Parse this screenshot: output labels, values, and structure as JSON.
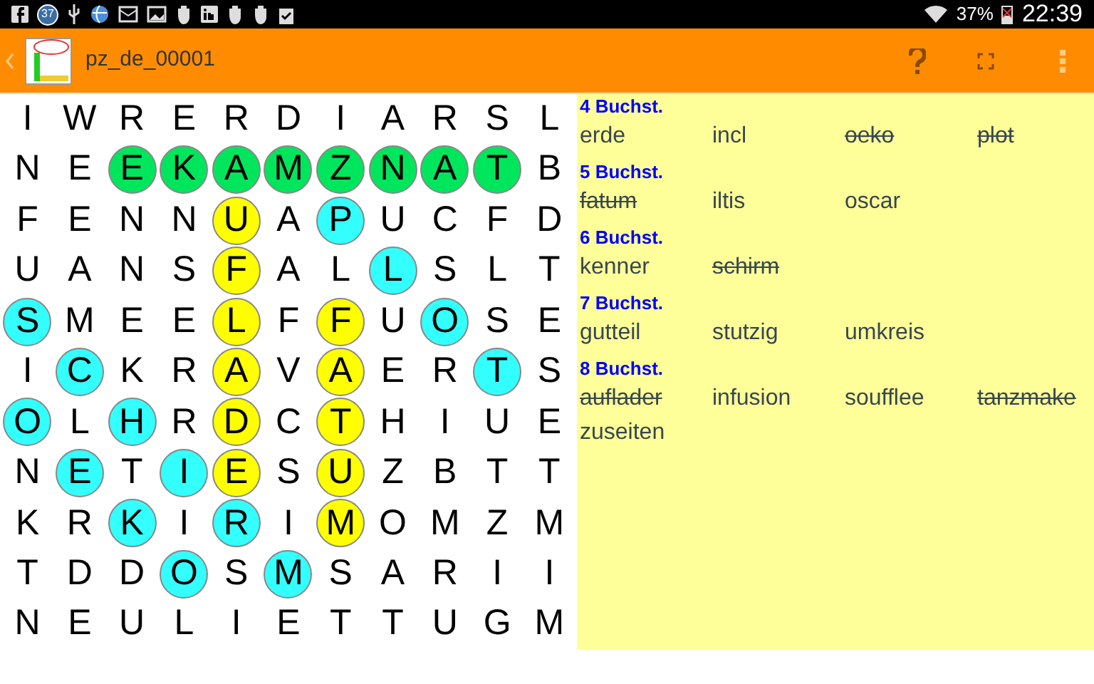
{
  "status_bar": {
    "notification_badge": "37",
    "battery": "37%",
    "time": "22:39"
  },
  "action_bar": {
    "title": "pz_de_00001"
  },
  "grid": {
    "rows": [
      [
        {
          "letter": "I"
        },
        {
          "letter": "W"
        },
        {
          "letter": "R"
        },
        {
          "letter": "E"
        },
        {
          "letter": "R"
        },
        {
          "letter": "D"
        },
        {
          "letter": "I"
        },
        {
          "letter": "A"
        },
        {
          "letter": "R"
        },
        {
          "letter": "S"
        },
        {
          "letter": "L"
        }
      ],
      [
        {
          "letter": "N"
        },
        {
          "letter": "E"
        },
        {
          "letter": "E",
          "color": "#00e65c"
        },
        {
          "letter": "K",
          "color": "#00e65c"
        },
        {
          "letter": "A",
          "color": "#00e65c"
        },
        {
          "letter": "M",
          "color": "#00e65c"
        },
        {
          "letter": "Z",
          "color": "#00e65c"
        },
        {
          "letter": "N",
          "color": "#00e65c"
        },
        {
          "letter": "A",
          "color": "#00e65c"
        },
        {
          "letter": "T",
          "color": "#00e65c"
        },
        {
          "letter": "B"
        }
      ],
      [
        {
          "letter": "F"
        },
        {
          "letter": "E"
        },
        {
          "letter": "N"
        },
        {
          "letter": "N"
        },
        {
          "letter": "U",
          "color": "#ffff00"
        },
        {
          "letter": "A"
        },
        {
          "letter": "P",
          "color": "#33ffff"
        },
        {
          "letter": "U"
        },
        {
          "letter": "C"
        },
        {
          "letter": "F"
        },
        {
          "letter": "D"
        }
      ],
      [
        {
          "letter": "U"
        },
        {
          "letter": "A"
        },
        {
          "letter": "N"
        },
        {
          "letter": "S"
        },
        {
          "letter": "F",
          "color": "#ffff00"
        },
        {
          "letter": "A"
        },
        {
          "letter": "L"
        },
        {
          "letter": "L",
          "color": "#33ffff"
        },
        {
          "letter": "S"
        },
        {
          "letter": "L"
        },
        {
          "letter": "T"
        }
      ],
      [
        {
          "letter": "S",
          "color": "#33ffff"
        },
        {
          "letter": "M"
        },
        {
          "letter": "E"
        },
        {
          "letter": "E"
        },
        {
          "letter": "L",
          "color": "#ffff00"
        },
        {
          "letter": "F"
        },
        {
          "letter": "F",
          "color": "#ffff00"
        },
        {
          "letter": "U"
        },
        {
          "letter": "O",
          "color": "#33ffff"
        },
        {
          "letter": "S"
        },
        {
          "letter": "E"
        }
      ],
      [
        {
          "letter": "I"
        },
        {
          "letter": "C",
          "color": "#33ffff"
        },
        {
          "letter": "K"
        },
        {
          "letter": "R"
        },
        {
          "letter": "A",
          "color": "#ffff00"
        },
        {
          "letter": "V"
        },
        {
          "letter": "A",
          "color": "#ffff00"
        },
        {
          "letter": "E"
        },
        {
          "letter": "R"
        },
        {
          "letter": "T",
          "color": "#33ffff"
        },
        {
          "letter": "S"
        }
      ],
      [
        {
          "letter": "O",
          "color": "#33ffff"
        },
        {
          "letter": "L"
        },
        {
          "letter": "H",
          "color": "#33ffff"
        },
        {
          "letter": "R"
        },
        {
          "letter": "D",
          "color": "#ffff00"
        },
        {
          "letter": "C"
        },
        {
          "letter": "T",
          "color": "#ffff00"
        },
        {
          "letter": "H"
        },
        {
          "letter": "I"
        },
        {
          "letter": "U"
        },
        {
          "letter": "E"
        }
      ],
      [
        {
          "letter": "N"
        },
        {
          "letter": "E",
          "color": "#33ffff"
        },
        {
          "letter": "T"
        },
        {
          "letter": "I",
          "color": "#33ffff"
        },
        {
          "letter": "E",
          "color": "#ffff00"
        },
        {
          "letter": "S"
        },
        {
          "letter": "U",
          "color": "#ffff00"
        },
        {
          "letter": "Z"
        },
        {
          "letter": "B"
        },
        {
          "letter": "T"
        },
        {
          "letter": "T"
        }
      ],
      [
        {
          "letter": "K"
        },
        {
          "letter": "R"
        },
        {
          "letter": "K",
          "color": "#33ffff"
        },
        {
          "letter": "I"
        },
        {
          "letter": "R",
          "color": "#33ffff"
        },
        {
          "letter": "I"
        },
        {
          "letter": "M",
          "color": "#ffff00"
        },
        {
          "letter": "O"
        },
        {
          "letter": "M"
        },
        {
          "letter": "Z"
        },
        {
          "letter": "M"
        }
      ],
      [
        {
          "letter": "T"
        },
        {
          "letter": "D"
        },
        {
          "letter": "D"
        },
        {
          "letter": "O",
          "color": "#33ffff"
        },
        {
          "letter": "S"
        },
        {
          "letter": "M",
          "color": "#33ffff"
        },
        {
          "letter": "S"
        },
        {
          "letter": "A"
        },
        {
          "letter": "R"
        },
        {
          "letter": "I"
        },
        {
          "letter": "I"
        }
      ],
      [
        {
          "letter": "N"
        },
        {
          "letter": "E"
        },
        {
          "letter": "U"
        },
        {
          "letter": "L"
        },
        {
          "letter": "I"
        },
        {
          "letter": "E"
        },
        {
          "letter": "T"
        },
        {
          "letter": "T"
        },
        {
          "letter": "U"
        },
        {
          "letter": "G"
        },
        {
          "letter": "M"
        }
      ]
    ]
  },
  "word_list": [
    {
      "heading": "4 Buchst.",
      "words": [
        {
          "text": "erde",
          "found": false
        },
        {
          "text": "incl",
          "found": false
        },
        {
          "text": "oeko",
          "found": true
        },
        {
          "text": "plot",
          "found": true
        }
      ]
    },
    {
      "heading": "5 Buchst.",
      "words": [
        {
          "text": "fatum",
          "found": true
        },
        {
          "text": "iltis",
          "found": false
        },
        {
          "text": "oscar",
          "found": false
        }
      ]
    },
    {
      "heading": "6 Buchst.",
      "words": [
        {
          "text": "kenner",
          "found": false
        },
        {
          "text": "schirm",
          "found": true
        }
      ]
    },
    {
      "heading": "7 Buchst.",
      "words": [
        {
          "text": "gutteil",
          "found": false
        },
        {
          "text": "stutzig",
          "found": false
        },
        {
          "text": "umkreis",
          "found": false
        }
      ]
    },
    {
      "heading": "8 Buchst.",
      "words": [
        {
          "text": "auflader",
          "found": true
        },
        {
          "text": "infusion",
          "found": false
        },
        {
          "text": "soufflee",
          "found": false
        },
        {
          "text": "tanzmake",
          "found": true
        },
        {
          "text": "zuseiten",
          "found": false
        }
      ]
    }
  ]
}
